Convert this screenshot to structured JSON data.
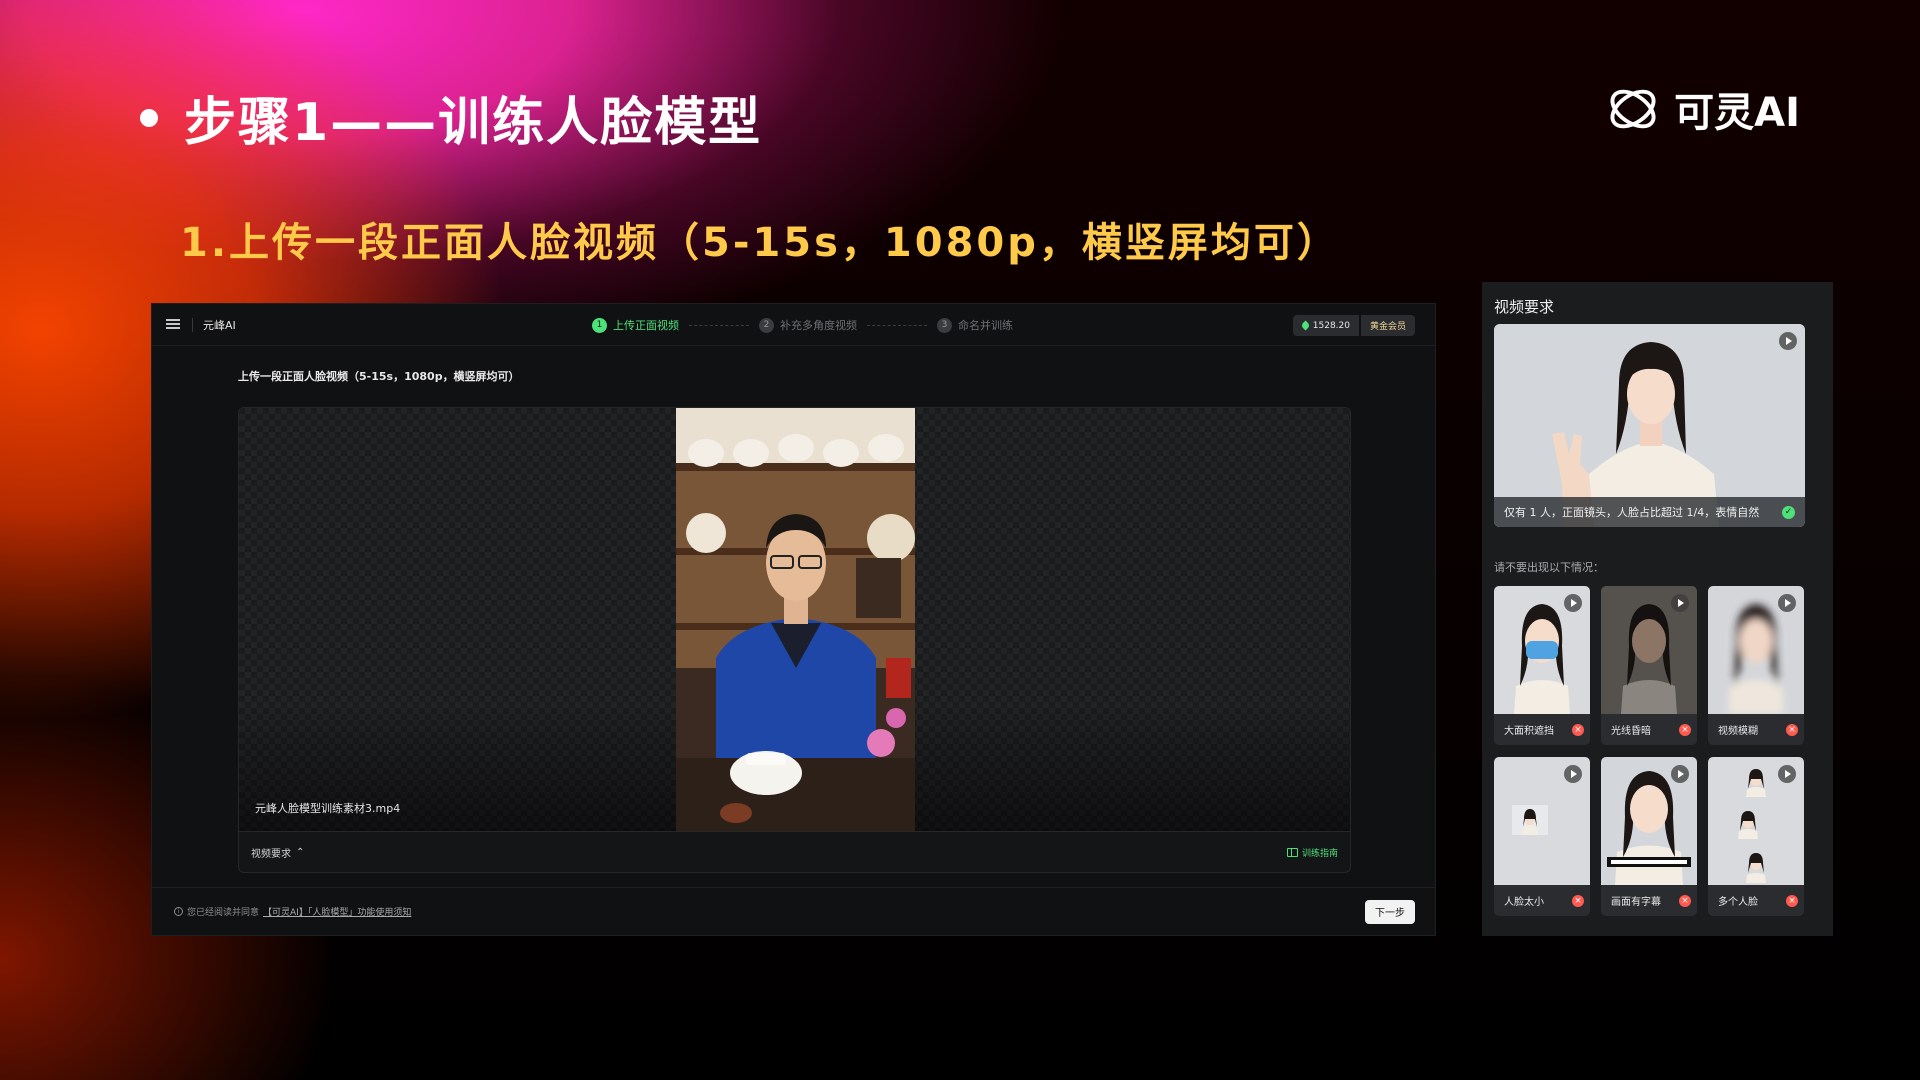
{
  "slide": {
    "title": "步骤1——训练人脸模型",
    "subtitle": "1.上传一段正面人脸视频（5-15s，1080p，横竖屏均可）",
    "brand": "可灵AI"
  },
  "app": {
    "name": "元峰AI",
    "steps": [
      {
        "num": "1",
        "label": "上传正面视频",
        "active": true
      },
      {
        "num": "2",
        "label": "补充多角度视频",
        "active": false
      },
      {
        "num": "3",
        "label": "命名并训练",
        "active": false
      }
    ],
    "credits": "1528.20",
    "membership": "黄金会员",
    "heading": "上传一段正面人脸视频（5-15s，1080p，横竖屏均可）",
    "file_name": "元峰人脸模型训练素材3.mp4",
    "requirements_toggle": "视频要求",
    "guide_link": "训练指南",
    "notice_prefix": "您已经阅读并同意",
    "notice_link": "【可灵AI】「人脸模型」功能使用须知",
    "next_button": "下一步"
  },
  "requirements": {
    "title": "视频要求",
    "good_caption": "仅有 1 人，正面镜头，人脸占比超过 1/4，表情自然",
    "bad_intro": "请不要出现以下情况：",
    "bad_examples": [
      {
        "label": "大面积遮挡"
      },
      {
        "label": "光线昏暗"
      },
      {
        "label": "视频模糊"
      },
      {
        "label": "人脸太小"
      },
      {
        "label": "画面有字幕"
      },
      {
        "label": "多个人脸"
      }
    ]
  },
  "colors": {
    "accent_green": "#4ee07a",
    "warning_red": "#ff5a4f",
    "subtitle_gold": "#ffc94a"
  }
}
